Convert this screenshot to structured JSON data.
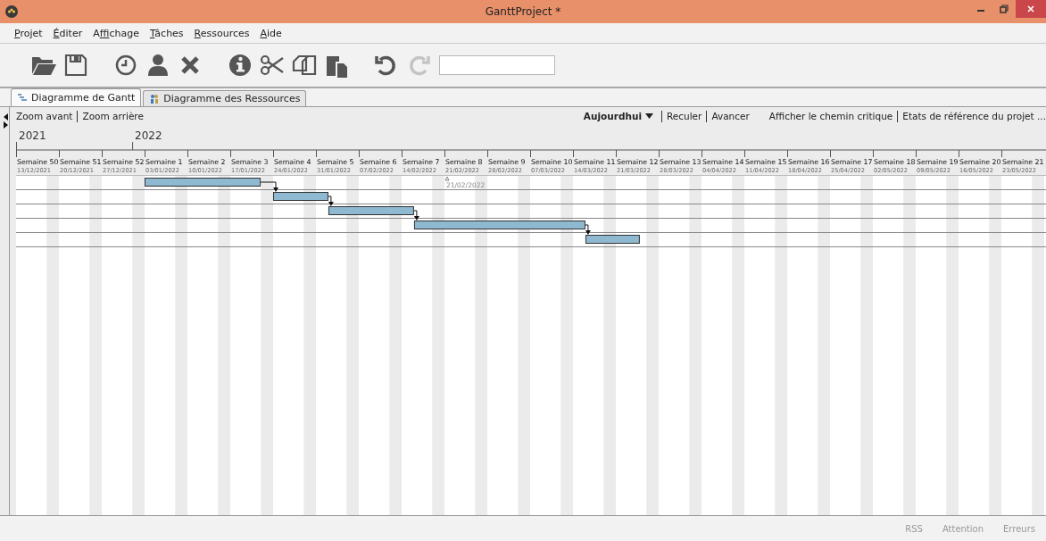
{
  "window": {
    "title": "GanttProject *"
  },
  "menu": [
    {
      "key": "P",
      "rest": "rojet"
    },
    {
      "key": "É",
      "rest": "diter"
    },
    {
      "lead": "A",
      "key": "f",
      "rest": "fichage"
    },
    {
      "key": "T",
      "rest": "âches"
    },
    {
      "key": "R",
      "rest": "essources"
    },
    {
      "key": "A",
      "rest": "ide"
    }
  ],
  "toolbar": [
    {
      "kind": "open",
      "disabled": false
    },
    {
      "kind": "save",
      "disabled": false
    },
    {
      "kind": "gap"
    },
    {
      "kind": "clock",
      "disabled": false
    },
    {
      "kind": "person",
      "disabled": false
    },
    {
      "kind": "delete",
      "disabled": false
    },
    {
      "kind": "gap"
    },
    {
      "kind": "info",
      "disabled": false
    },
    {
      "kind": "cut",
      "disabled": false
    },
    {
      "kind": "copy",
      "disabled": false
    },
    {
      "kind": "paste",
      "disabled": false
    },
    {
      "kind": "gap"
    },
    {
      "kind": "undo",
      "disabled": false
    },
    {
      "kind": "redo",
      "disabled": true
    },
    {
      "kind": "search"
    }
  ],
  "tabs": [
    {
      "label": "Diagramme de Gantt",
      "kind": "gantt",
      "selected": true
    },
    {
      "label": "Diagramme des Ressources",
      "kind": "resources",
      "selected": false
    }
  ],
  "chart_toolbar": {
    "left": [
      "Zoom avant",
      "Zoom arrière"
    ],
    "today": "Aujourdhui",
    "nav": [
      "Reculer",
      "Avancer"
    ],
    "right": [
      "Afficher le chemin critique",
      "Etats de référence du projet ..."
    ]
  },
  "years": [
    "2021",
    "2022"
  ],
  "weeks": [
    {
      "label": "Semaine 50",
      "date": "13/12/2021"
    },
    {
      "label": "Semaine 51",
      "date": "20/12/2021"
    },
    {
      "label": "Semaine 52",
      "date": "27/12/2021"
    },
    {
      "label": "Semaine 1",
      "date": "03/01/2022"
    },
    {
      "label": "Semaine 2",
      "date": "10/01/2022"
    },
    {
      "label": "Semaine 3",
      "date": "17/01/2022"
    },
    {
      "label": "Semaine 4",
      "date": "24/01/2022"
    },
    {
      "label": "Semaine 5",
      "date": "31/01/2022"
    },
    {
      "label": "Semaine 6",
      "date": "07/02/2022"
    },
    {
      "label": "Semaine 7",
      "date": "14/02/2022"
    },
    {
      "label": "Semaine 8",
      "date": "21/02/2022"
    },
    {
      "label": "Semaine 9",
      "date": "28/02/2022"
    },
    {
      "label": "Semaine 10",
      "date": "07/03/2022"
    },
    {
      "label": "Semaine 11",
      "date": "14/03/2022"
    },
    {
      "label": "Semaine 12",
      "date": "21/03/2022"
    },
    {
      "label": "Semaine 13",
      "date": "28/03/2022"
    },
    {
      "label": "Semaine 14",
      "date": "04/04/2022"
    },
    {
      "label": "Semaine 15",
      "date": "11/04/2022"
    },
    {
      "label": "Semaine 16",
      "date": "18/04/2022"
    },
    {
      "label": "Semaine 17",
      "date": "25/04/2022"
    },
    {
      "label": "Semaine 18",
      "date": "02/05/2022"
    },
    {
      "label": "Semaine 19",
      "date": "09/05/2022"
    },
    {
      "label": "Semaine 20",
      "date": "16/05/2022"
    },
    {
      "label": "Semaine 21",
      "date": "23/05/2022"
    }
  ],
  "today_date": "21/02/2022",
  "status_bar": [
    "RSS",
    "Attention",
    "Erreurs"
  ]
}
